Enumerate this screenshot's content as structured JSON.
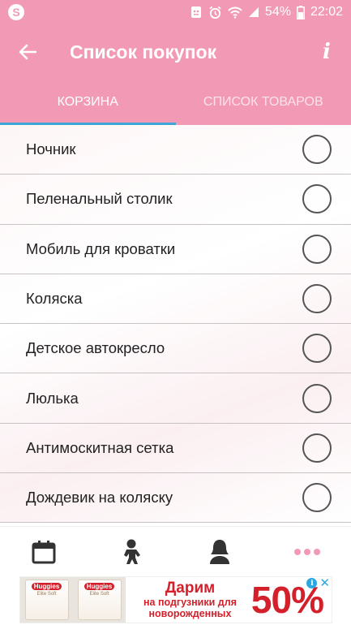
{
  "status_bar": {
    "app_icon": "S",
    "battery": "54%",
    "time": "22:02"
  },
  "app_bar": {
    "title": "Список покупок",
    "info_icon": "i"
  },
  "tabs": [
    {
      "label": "КОРЗИНА"
    },
    {
      "label": "СПИСОК ТОВАРОВ"
    }
  ],
  "items": [
    {
      "label": "Ночник"
    },
    {
      "label": "Пеленальный столик"
    },
    {
      "label": "Мобиль для кроватки"
    },
    {
      "label": "Коляска"
    },
    {
      "label": "Детское автокресло"
    },
    {
      "label": "Люлька"
    },
    {
      "label": "Антимоскитная сетка"
    },
    {
      "label": "Дождевик на коляску"
    }
  ],
  "bottom_nav": {
    "items": [
      "calendar-icon",
      "baby-icon",
      "mother-icon",
      "more-dots-icon"
    ]
  },
  "ad": {
    "brand": "Huggies",
    "product": "Elite Soft",
    "headline": "Дарим",
    "line1": "на подгузники для",
    "line2": "новорожденных",
    "percent": "50%"
  },
  "colors": {
    "primary": "#f29ab5",
    "tab_indicator": "#3fa4d6",
    "accent_dots": "#f29ab5",
    "ad_red": "#d4202a"
  }
}
